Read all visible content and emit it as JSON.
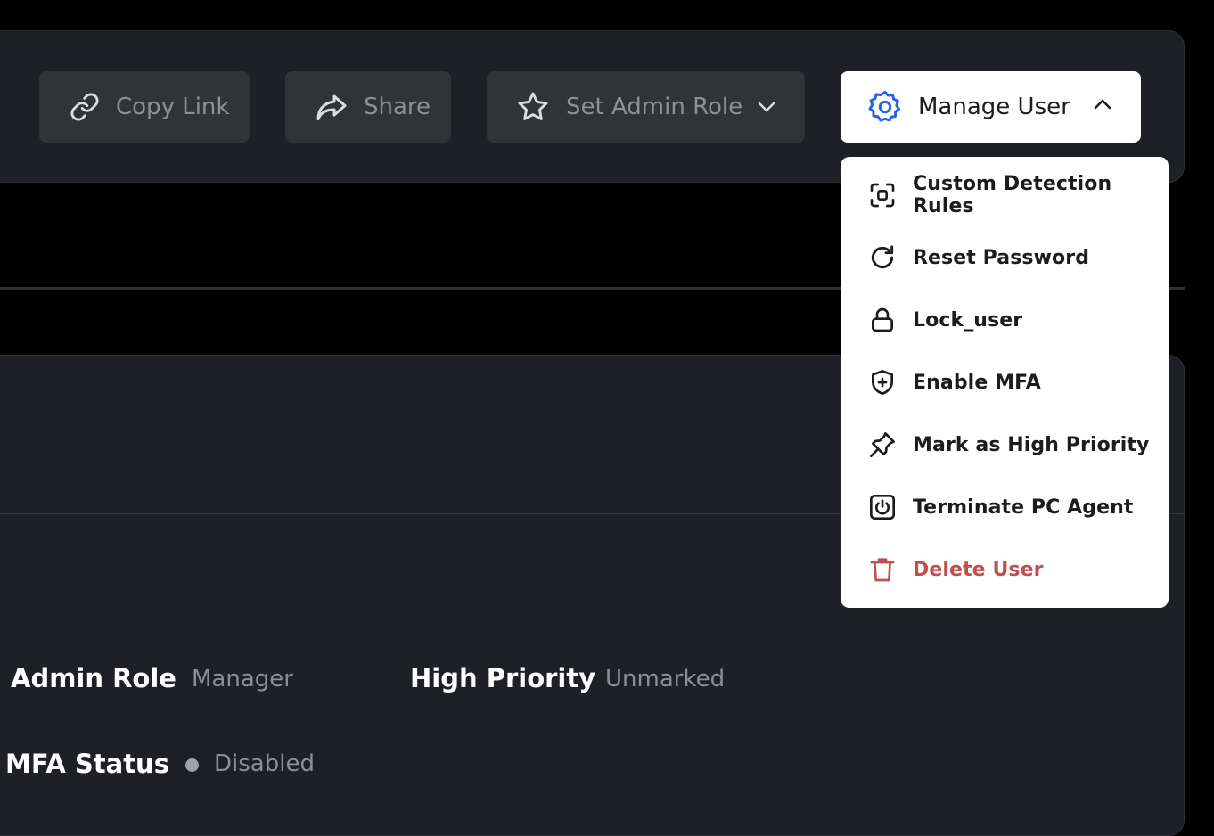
{
  "toolbar": {
    "copy_link_label": "Copy Link",
    "share_label": "Share",
    "set_admin_role_label": "Set Admin Role",
    "manage_user_label": "Manage User"
  },
  "manage_menu": {
    "items": [
      {
        "label": "Custom Detection Rules",
        "icon": "scan-icon"
      },
      {
        "label": "Reset Password",
        "icon": "refresh-icon"
      },
      {
        "label": "Lock_user",
        "icon": "lock-icon"
      },
      {
        "label": "Enable MFA",
        "icon": "shield-plus-icon"
      },
      {
        "label": "Mark as High Priority",
        "icon": "pin-icon"
      },
      {
        "label": "Terminate PC Agent",
        "icon": "power-icon"
      },
      {
        "label": "Delete User",
        "icon": "trash-icon",
        "color": "#c0504d"
      }
    ]
  },
  "details": {
    "admin_role_label": "Admin Role",
    "admin_role_value": "Manager",
    "high_priority_label": "High Priority",
    "high_priority_value": "Unmarked",
    "mfa_status_label": "MFA Status",
    "mfa_status_value": "Disabled"
  },
  "colors": {
    "accent": "#2563eb",
    "danger": "#c0504d",
    "panel": "#1f2025",
    "button": "#323335"
  }
}
